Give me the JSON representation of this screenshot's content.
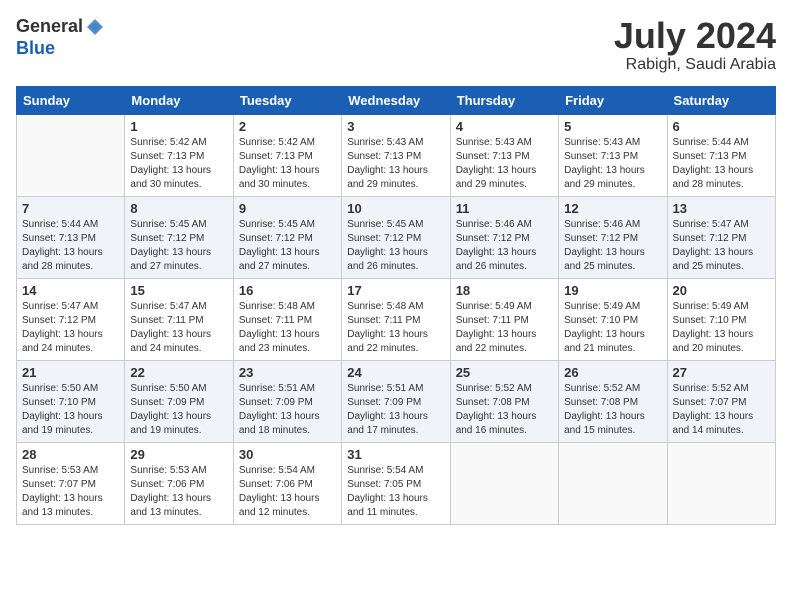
{
  "header": {
    "logo_line1": "General",
    "logo_line2": "Blue",
    "month_year": "July 2024",
    "location": "Rabigh, Saudi Arabia"
  },
  "weekdays": [
    "Sunday",
    "Monday",
    "Tuesday",
    "Wednesday",
    "Thursday",
    "Friday",
    "Saturday"
  ],
  "weeks": [
    [
      {
        "num": "",
        "info": ""
      },
      {
        "num": "1",
        "info": "Sunrise: 5:42 AM\nSunset: 7:13 PM\nDaylight: 13 hours\nand 30 minutes."
      },
      {
        "num": "2",
        "info": "Sunrise: 5:42 AM\nSunset: 7:13 PM\nDaylight: 13 hours\nand 30 minutes."
      },
      {
        "num": "3",
        "info": "Sunrise: 5:43 AM\nSunset: 7:13 PM\nDaylight: 13 hours\nand 29 minutes."
      },
      {
        "num": "4",
        "info": "Sunrise: 5:43 AM\nSunset: 7:13 PM\nDaylight: 13 hours\nand 29 minutes."
      },
      {
        "num": "5",
        "info": "Sunrise: 5:43 AM\nSunset: 7:13 PM\nDaylight: 13 hours\nand 29 minutes."
      },
      {
        "num": "6",
        "info": "Sunrise: 5:44 AM\nSunset: 7:13 PM\nDaylight: 13 hours\nand 28 minutes."
      }
    ],
    [
      {
        "num": "7",
        "info": "Sunrise: 5:44 AM\nSunset: 7:13 PM\nDaylight: 13 hours\nand 28 minutes."
      },
      {
        "num": "8",
        "info": "Sunrise: 5:45 AM\nSunset: 7:12 PM\nDaylight: 13 hours\nand 27 minutes."
      },
      {
        "num": "9",
        "info": "Sunrise: 5:45 AM\nSunset: 7:12 PM\nDaylight: 13 hours\nand 27 minutes."
      },
      {
        "num": "10",
        "info": "Sunrise: 5:45 AM\nSunset: 7:12 PM\nDaylight: 13 hours\nand 26 minutes."
      },
      {
        "num": "11",
        "info": "Sunrise: 5:46 AM\nSunset: 7:12 PM\nDaylight: 13 hours\nand 26 minutes."
      },
      {
        "num": "12",
        "info": "Sunrise: 5:46 AM\nSunset: 7:12 PM\nDaylight: 13 hours\nand 25 minutes."
      },
      {
        "num": "13",
        "info": "Sunrise: 5:47 AM\nSunset: 7:12 PM\nDaylight: 13 hours\nand 25 minutes."
      }
    ],
    [
      {
        "num": "14",
        "info": "Sunrise: 5:47 AM\nSunset: 7:12 PM\nDaylight: 13 hours\nand 24 minutes."
      },
      {
        "num": "15",
        "info": "Sunrise: 5:47 AM\nSunset: 7:11 PM\nDaylight: 13 hours\nand 24 minutes."
      },
      {
        "num": "16",
        "info": "Sunrise: 5:48 AM\nSunset: 7:11 PM\nDaylight: 13 hours\nand 23 minutes."
      },
      {
        "num": "17",
        "info": "Sunrise: 5:48 AM\nSunset: 7:11 PM\nDaylight: 13 hours\nand 22 minutes."
      },
      {
        "num": "18",
        "info": "Sunrise: 5:49 AM\nSunset: 7:11 PM\nDaylight: 13 hours\nand 22 minutes."
      },
      {
        "num": "19",
        "info": "Sunrise: 5:49 AM\nSunset: 7:10 PM\nDaylight: 13 hours\nand 21 minutes."
      },
      {
        "num": "20",
        "info": "Sunrise: 5:49 AM\nSunset: 7:10 PM\nDaylight: 13 hours\nand 20 minutes."
      }
    ],
    [
      {
        "num": "21",
        "info": "Sunrise: 5:50 AM\nSunset: 7:10 PM\nDaylight: 13 hours\nand 19 minutes."
      },
      {
        "num": "22",
        "info": "Sunrise: 5:50 AM\nSunset: 7:09 PM\nDaylight: 13 hours\nand 19 minutes."
      },
      {
        "num": "23",
        "info": "Sunrise: 5:51 AM\nSunset: 7:09 PM\nDaylight: 13 hours\nand 18 minutes."
      },
      {
        "num": "24",
        "info": "Sunrise: 5:51 AM\nSunset: 7:09 PM\nDaylight: 13 hours\nand 17 minutes."
      },
      {
        "num": "25",
        "info": "Sunrise: 5:52 AM\nSunset: 7:08 PM\nDaylight: 13 hours\nand 16 minutes."
      },
      {
        "num": "26",
        "info": "Sunrise: 5:52 AM\nSunset: 7:08 PM\nDaylight: 13 hours\nand 15 minutes."
      },
      {
        "num": "27",
        "info": "Sunrise: 5:52 AM\nSunset: 7:07 PM\nDaylight: 13 hours\nand 14 minutes."
      }
    ],
    [
      {
        "num": "28",
        "info": "Sunrise: 5:53 AM\nSunset: 7:07 PM\nDaylight: 13 hours\nand 13 minutes."
      },
      {
        "num": "29",
        "info": "Sunrise: 5:53 AM\nSunset: 7:06 PM\nDaylight: 13 hours\nand 13 minutes."
      },
      {
        "num": "30",
        "info": "Sunrise: 5:54 AM\nSunset: 7:06 PM\nDaylight: 13 hours\nand 12 minutes."
      },
      {
        "num": "31",
        "info": "Sunrise: 5:54 AM\nSunset: 7:05 PM\nDaylight: 13 hours\nand 11 minutes."
      },
      {
        "num": "",
        "info": ""
      },
      {
        "num": "",
        "info": ""
      },
      {
        "num": "",
        "info": ""
      }
    ]
  ]
}
